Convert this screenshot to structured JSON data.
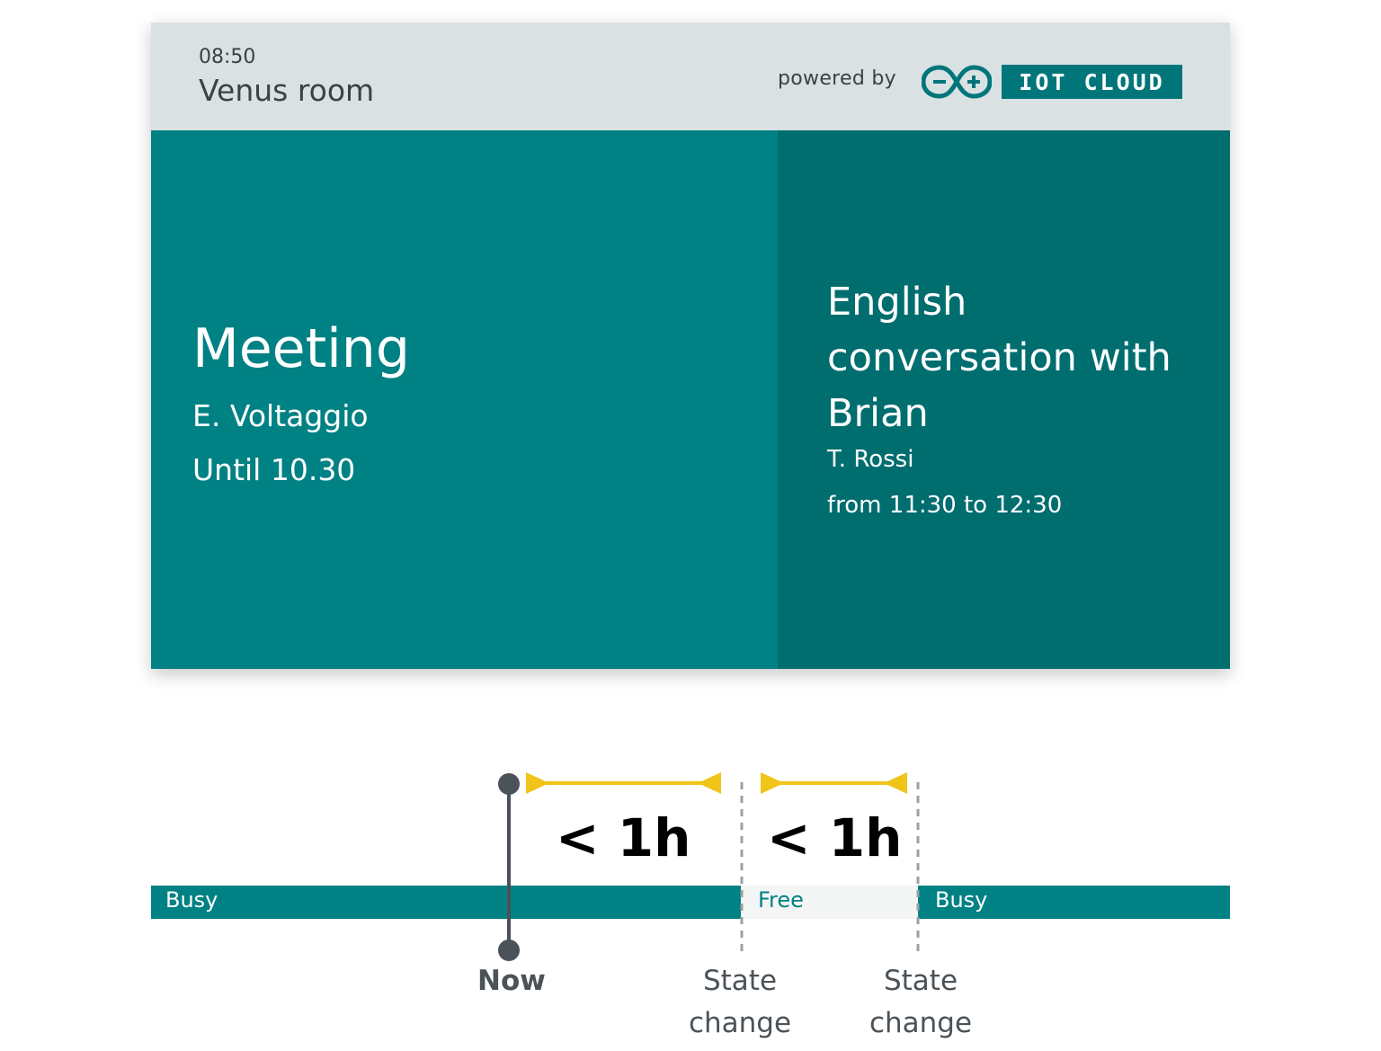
{
  "header": {
    "clock": "08:50",
    "room": "Venus room",
    "powered_by": "powered by",
    "brand_badge": "IOT CLOUD",
    "brand_logo_icon": "arduino-infinity-logo-icon"
  },
  "current_meeting": {
    "title": "Meeting",
    "organizer": "E. Voltaggio",
    "until": "Until 10.30"
  },
  "next_meeting": {
    "title": "English conversation with Brian",
    "organizer": "T. Rossi",
    "time": "from 11:30 to 12:30"
  },
  "timeline": {
    "segments": [
      {
        "label": "Busy",
        "state": "busy"
      },
      {
        "label": "Free",
        "state": "free"
      },
      {
        "label": "Busy",
        "state": "busy"
      }
    ],
    "gaps": [
      "< 1h",
      "< 1h"
    ],
    "markers": {
      "now": "Now",
      "state_change_1": [
        "State",
        "change"
      ],
      "state_change_2": [
        "State",
        "change"
      ]
    }
  },
  "colors": {
    "header_bg": "#dae1e3",
    "current_bg": "#008184",
    "next_bg": "#006d6f",
    "brand": "#00767a",
    "busy": "#008184",
    "free": "#f4f6f6",
    "interval_arrow": "#f0c419",
    "now_marker": "#4b5258"
  }
}
